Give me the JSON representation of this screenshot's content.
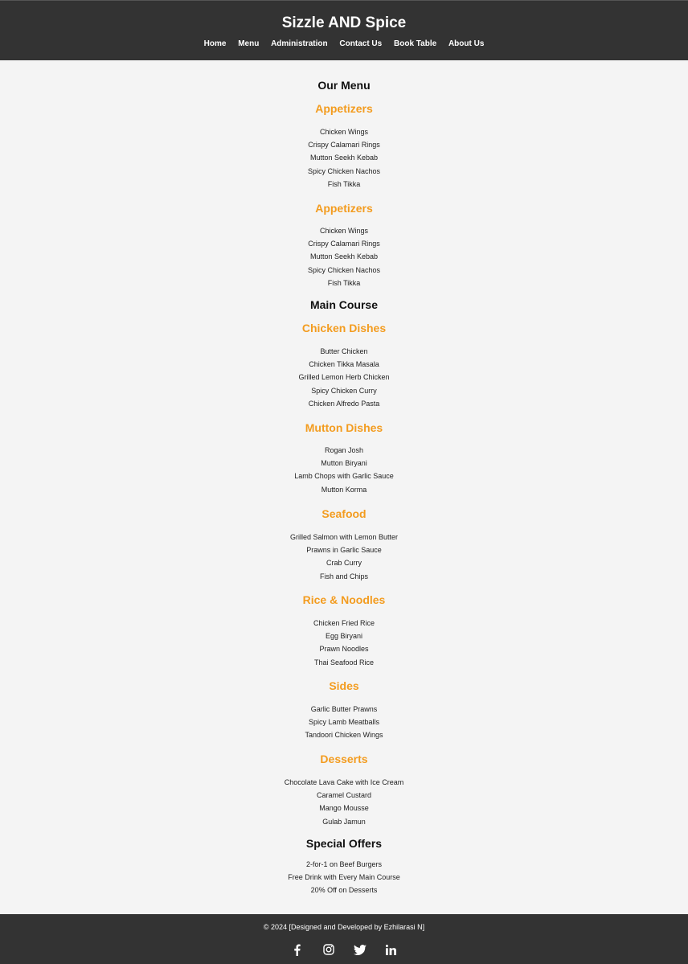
{
  "header": {
    "title": "Sizzle AND Spice",
    "nav": [
      "Home",
      "Menu",
      "Administration",
      "Contact Us",
      "Book Table",
      "About Us"
    ]
  },
  "sections": {
    "our_menu": "Our Menu",
    "main_course": "Main Course",
    "special_offers": "Special Offers"
  },
  "categories": [
    {
      "title": "Appetizers",
      "items": [
        "Chicken Wings",
        "Crispy Calamari Rings",
        "Mutton Seekh Kebab",
        "Spicy Chicken Nachos",
        "Fish Tikka"
      ]
    },
    {
      "title": "Appetizers",
      "items": [
        "Chicken Wings",
        "Crispy Calamari Rings",
        "Mutton Seekh Kebab",
        "Spicy Chicken Nachos",
        "Fish Tikka"
      ]
    },
    {
      "title": "Chicken Dishes",
      "items": [
        "Butter Chicken",
        "Chicken Tikka Masala",
        "Grilled Lemon Herb Chicken",
        "Spicy Chicken Curry",
        "Chicken Alfredo Pasta"
      ]
    },
    {
      "title": "Mutton Dishes",
      "items": [
        "Rogan Josh",
        "Mutton Biryani",
        "Lamb Chops with Garlic Sauce",
        "Mutton Korma"
      ]
    },
    {
      "title": "Seafood",
      "items": [
        "Grilled Salmon with Lemon Butter",
        "Prawns in Garlic Sauce",
        "Crab Curry",
        "Fish and Chips"
      ]
    },
    {
      "title": "Rice & Noodles",
      "items": [
        "Chicken Fried Rice",
        "Egg Biryani",
        "Prawn Noodles",
        "Thai Seafood Rice"
      ]
    },
    {
      "title": "Sides",
      "items": [
        "Garlic Butter Prawns",
        "Spicy Lamb Meatballs",
        "Tandoori Chicken Wings"
      ]
    },
    {
      "title": "Desserts",
      "items": [
        "Chocolate Lava Cake with Ice Cream",
        "Caramel Custard",
        "Mango Mousse",
        "Gulab Jamun"
      ]
    }
  ],
  "offers": [
    "2-for-1 on Beef Burgers",
    "Free Drink with Every Main Course",
    "20% Off on Desserts"
  ],
  "footer": {
    "copyright": "© 2024 [Designed and Developed by Ezhilarasi N]",
    "social": [
      "facebook-icon",
      "instagram-icon",
      "twitter-icon",
      "linkedin-icon"
    ]
  },
  "colors": {
    "header_bg": "#333333",
    "accent": "#f39c1f",
    "page_bg": "#f4f4f4"
  }
}
